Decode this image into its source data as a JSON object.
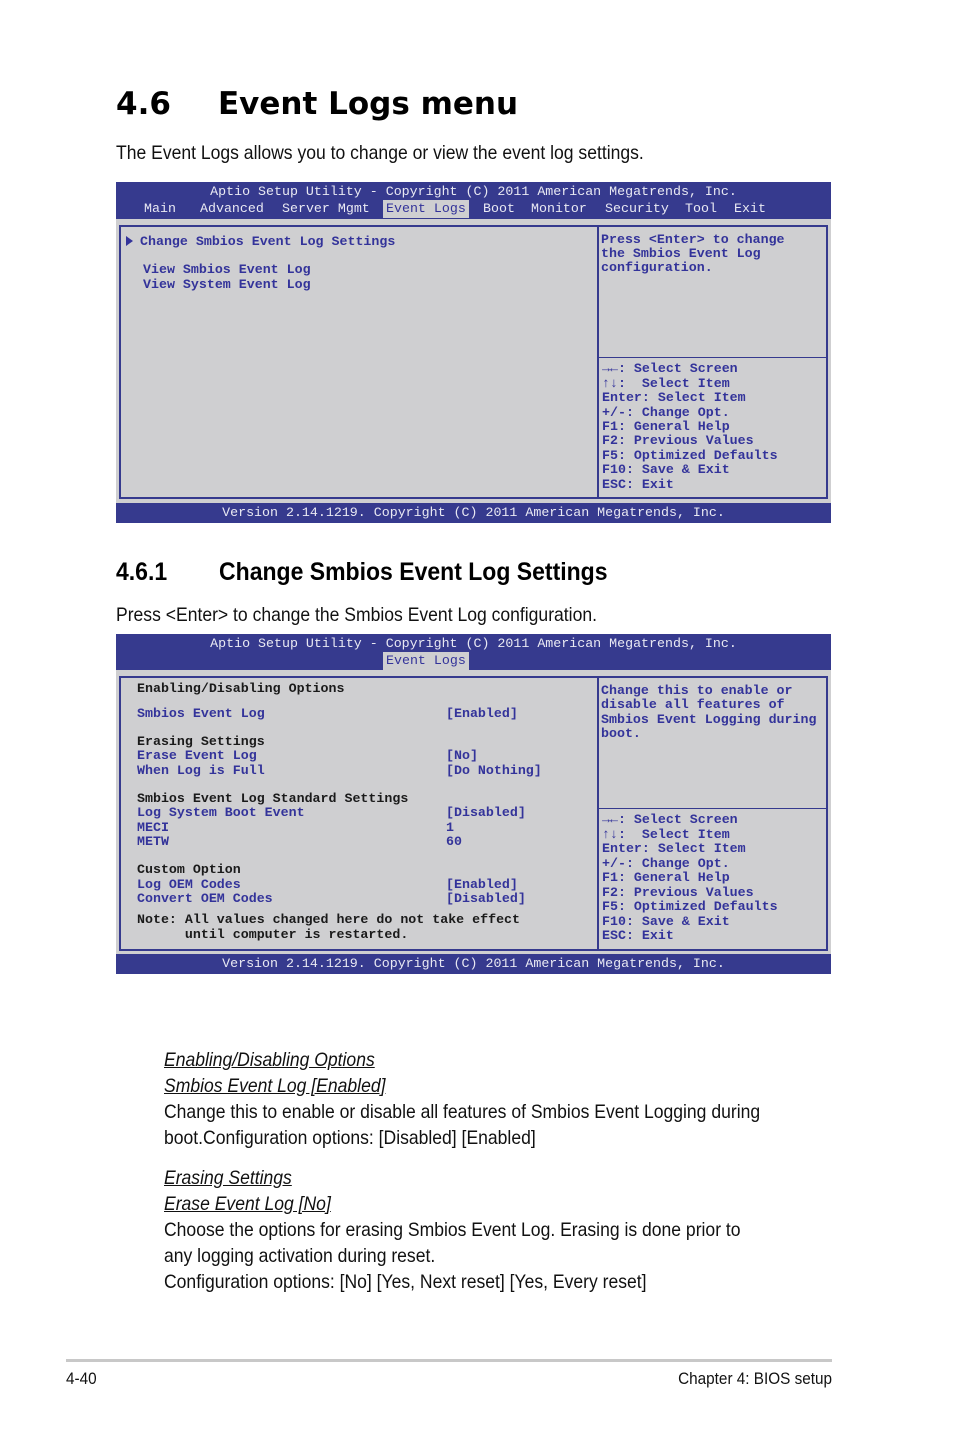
{
  "section": {
    "number": "4.6",
    "title": "Event Logs menu",
    "intro": "The Event Logs allows you to change or view the event log settings."
  },
  "bios1": {
    "title": "Aptio Setup Utility - Copyright (C) 2011 American Megatrends, Inc.",
    "tabs": [
      {
        "label": "Main",
        "active": false
      },
      {
        "label": "Advanced",
        "active": false
      },
      {
        "label": "Server Mgmt",
        "active": false
      },
      {
        "label": "Event Logs",
        "active": true
      },
      {
        "label": "Boot",
        "active": false
      },
      {
        "label": "Monitor",
        "active": false
      },
      {
        "label": "Security",
        "active": false
      },
      {
        "label": "Tool",
        "active": false
      },
      {
        "label": "Exit",
        "active": false
      }
    ],
    "items": [
      {
        "label": "Change Smbios Event Log Settings",
        "submenu": true
      },
      {
        "label": "View Smbios Event Log"
      },
      {
        "label": "View System Event Log"
      }
    ],
    "help": [
      "Press <Enter> to change",
      "the Smbios Event Log",
      "configuration."
    ],
    "keys": [
      "→←: Select Screen",
      "↑↓:  Select Item",
      "Enter: Select Item",
      "+/-: Change Opt.",
      "F1: General Help",
      "F2: Previous Values",
      "F5: Optimized Defaults",
      "F10: Save & Exit",
      "ESC: Exit"
    ],
    "footer": "Version 2.14.1219. Copyright (C) 2011 American Megatrends, Inc."
  },
  "subsection": {
    "number": "4.6.1",
    "title": "Change Smbios Event Log Settings",
    "intro": "Press <Enter> to change the Smbios Event Log configuration."
  },
  "bios2": {
    "title": "Aptio Setup Utility - Copyright (C) 2011 American Megatrends, Inc.",
    "tab": "Event Logs",
    "groups": {
      "enabling": "Enabling/Disabling Options",
      "erasing": "Erasing Settings",
      "standard": "Smbios Event Log Standard Settings",
      "custom": "Custom Option"
    },
    "settings": {
      "smbios_event_log": {
        "label": "Smbios Event Log",
        "value": "[Enabled]"
      },
      "erase_event_log": {
        "label": "Erase Event Log",
        "value": "[No]"
      },
      "when_log_full": {
        "label": "When Log is Full",
        "value": "[Do Nothing]"
      },
      "log_system_boot": {
        "label": "Log System Boot Event",
        "value": "[Disabled]"
      },
      "meci": {
        "label": "MECI",
        "value": "1"
      },
      "metw": {
        "label": "METW",
        "value": "60"
      },
      "log_oem_codes": {
        "label": "Log OEM Codes",
        "value": "[Enabled]"
      },
      "convert_oem_codes": {
        "label": "Convert OEM Codes",
        "value": "[Disabled]"
      }
    },
    "note_line1": "Note: All values changed here do not take effect",
    "note_line2": "      until computer is restarted.",
    "help": [
      "Change this to enable or",
      "disable all features of",
      "Smbios Event Logging during",
      "boot."
    ],
    "keys": [
      "→←: Select Screen",
      "↑↓:  Select Item",
      "Enter: Select Item",
      "+/-: Change Opt.",
      "F1: General Help",
      "F2: Previous Values",
      "F5: Optimized Defaults",
      "F10: Save & Exit",
      "ESC: Exit"
    ],
    "footer": "Version 2.14.1219. Copyright (C) 2011 American Megatrends, Inc."
  },
  "descriptions": [
    {
      "group": "Enabling/Disabling Options",
      "item": "Smbios Event Log [Enabled]",
      "lines": [
        "Change this to enable or disable all features of Smbios Event Logging during",
        "boot.Configuration options: [Disabled] [Enabled]"
      ]
    },
    {
      "group": "Erasing Settings",
      "item": "Erase Event Log [No]",
      "lines": [
        "Choose the options for erasing Smbios Event Log. Erasing is done prior to",
        "any logging activation during reset.",
        "Configuration options: [No] [Yes, Next reset] [Yes, Every reset]"
      ]
    }
  ],
  "footer": {
    "page": "4-40",
    "chapter": "Chapter 4: BIOS setup"
  }
}
